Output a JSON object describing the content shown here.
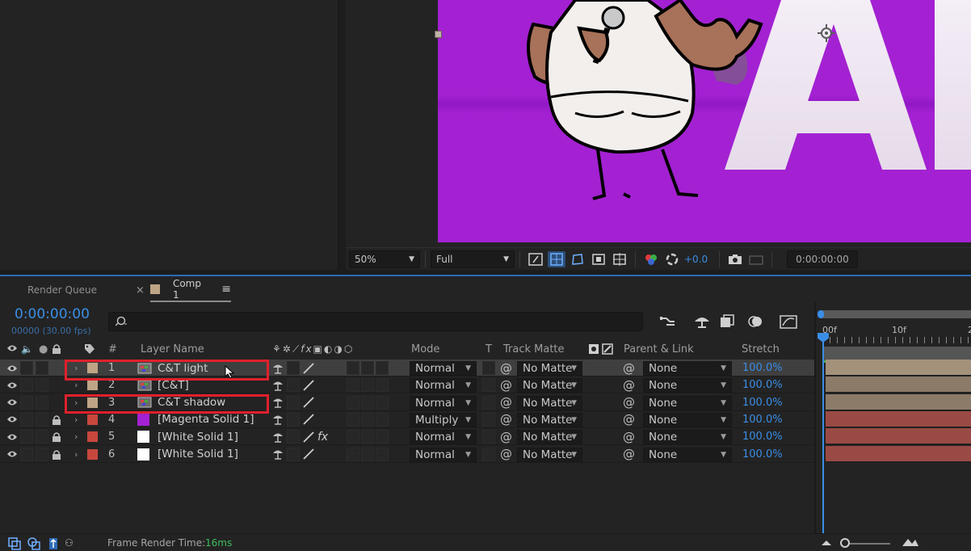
{
  "viewer": {
    "zoom": "50%",
    "resolution": "Full",
    "exposure": "+0.0",
    "time": "0:00:00:00",
    "canvas_color": "#a321d2"
  },
  "tabs": {
    "render_queue": "Render Queue",
    "comp": "Comp 1"
  },
  "timeline": {
    "timecode": "0:00:00:00",
    "frames_fps": "00000 (30.00 fps)",
    "ruler": [
      "00f",
      "10f"
    ]
  },
  "columns": {
    "number": "#",
    "layer_name": "Layer Name",
    "mode": "Mode",
    "t": "T",
    "track_matte": "Track Matte",
    "parent_link": "Parent & Link",
    "stretch": "Stretch"
  },
  "layers": [
    {
      "num": "1",
      "name": "C&T light",
      "mode": "Normal",
      "matte": "No Matte",
      "parent": "None",
      "stretch": "100.0%",
      "label_color": "#bfa586",
      "icon": "comp",
      "locked": false,
      "selected": true
    },
    {
      "num": "2",
      "name": "[C&T]",
      "mode": "Normal",
      "matte": "No Matte",
      "parent": "None",
      "stretch": "100.0%",
      "label_color": "#bfa586",
      "icon": "comp",
      "locked": false,
      "selected": false
    },
    {
      "num": "3",
      "name": "C&T shadow",
      "mode": "Normal",
      "matte": "No Matte",
      "parent": "None",
      "stretch": "100.0%",
      "label_color": "#bfa586",
      "icon": "comp",
      "locked": false,
      "selected": false
    },
    {
      "num": "4",
      "name": "[Magenta Solid 1]",
      "mode": "Multiply",
      "matte": "No Matte",
      "parent": "None",
      "stretch": "100.0%",
      "label_color": "#c8473d",
      "icon": "solid-magenta",
      "locked": true,
      "selected": false
    },
    {
      "num": "5",
      "name": "[White Solid 1]",
      "mode": "Normal",
      "matte": "No Matte",
      "parent": "None",
      "stretch": "100.0%",
      "label_color": "#c8473d",
      "icon": "solid-white",
      "locked": true,
      "selected": false,
      "fx": true
    },
    {
      "num": "6",
      "name": "[White Solid 1]",
      "mode": "Normal",
      "matte": "No Matte",
      "parent": "None",
      "stretch": "100.0%",
      "label_color": "#c8473d",
      "icon": "solid-white",
      "locked": true,
      "selected": false
    }
  ],
  "status": {
    "frame_render_label": "Frame Render Time:",
    "frame_render_value": "16ms"
  },
  "colors": {
    "accent": "#3a8ee6",
    "highlight_box": "#e0202c"
  }
}
